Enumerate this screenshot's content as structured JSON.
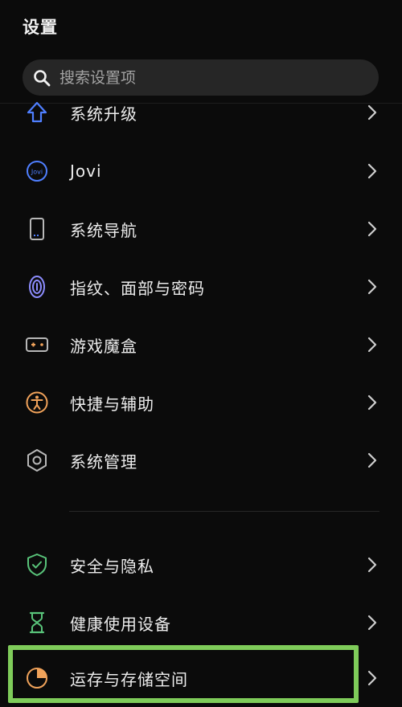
{
  "header": {
    "title": "设置"
  },
  "search": {
    "placeholder": "搜索设置项",
    "icon": "search-icon"
  },
  "items": [
    {
      "label": "系统升级",
      "icon": "upgrade-arrow-icon"
    },
    {
      "label": "Jovi",
      "icon": "jovi-icon"
    },
    {
      "label": "系统导航",
      "icon": "phone-navigation-icon"
    },
    {
      "label": "指纹、面部与密码",
      "icon": "fingerprint-icon"
    },
    {
      "label": "游戏魔盒",
      "icon": "gamepad-icon"
    },
    {
      "label": "快捷与辅助",
      "icon": "accessibility-icon"
    },
    {
      "label": "系统管理",
      "icon": "hexagon-gear-icon"
    },
    {
      "label": "安全与隐私",
      "icon": "shield-check-icon"
    },
    {
      "label": "健康使用设备",
      "icon": "hourglass-icon"
    },
    {
      "label": "运存与存储空间",
      "icon": "storage-pie-icon"
    }
  ],
  "colors": {
    "background": "#0b0b0b",
    "blue": "#4f7fff",
    "violet": "#8d8dff",
    "orange": "#f0a25a",
    "green": "#59c47a",
    "gray": "#b8b8b8",
    "highlight": "#7fcc5a"
  }
}
